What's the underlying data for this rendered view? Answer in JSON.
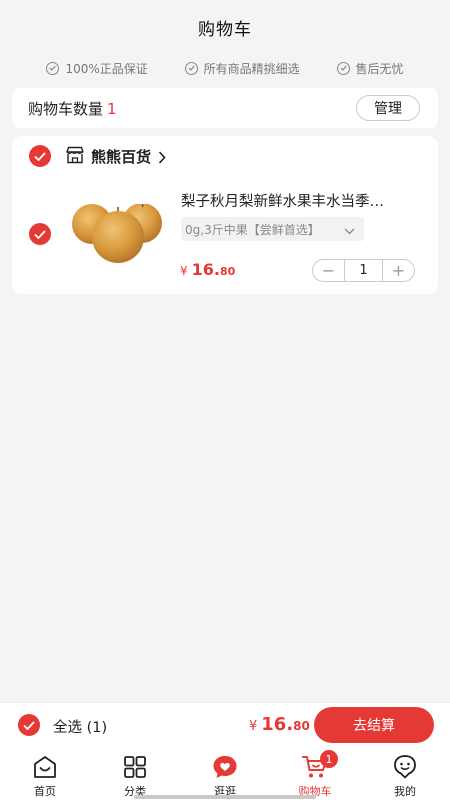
{
  "header": {
    "title": "购物车"
  },
  "guarantees": [
    {
      "label": "100%正品保证",
      "icon": "check-circle-icon"
    },
    {
      "label": "所有商品精挑细选",
      "icon": "check-circle-icon"
    },
    {
      "label": "售后无忧",
      "icon": "check-circle-icon"
    }
  ],
  "cart_count": {
    "label": "购物车数量",
    "value": "1",
    "manage_label": "管理"
  },
  "store": {
    "name": "熊熊百货",
    "item": {
      "title": "梨子秋月梨新鲜水果丰水当季…",
      "variant": "0g,3斤中果【尝鲜首选】",
      "price_currency": "¥",
      "price_int": "16.",
      "price_dec": "80",
      "quantity": "1",
      "minus": "−",
      "plus": "+"
    }
  },
  "checkout": {
    "select_all": "全选 (1)",
    "total_currency": "¥",
    "total_int": "16.",
    "total_dec": "80",
    "button": "去结算"
  },
  "tabs": [
    {
      "label": "首页",
      "icon": "home-icon"
    },
    {
      "label": "分类",
      "icon": "category-grid-icon"
    },
    {
      "label": "逛逛",
      "icon": "heart-chat-icon"
    },
    {
      "label": "购物车",
      "icon": "cart-icon",
      "badge": "1",
      "active": true
    },
    {
      "label": "我的",
      "icon": "profile-icon"
    }
  ],
  "colors": {
    "accent": "#e53935",
    "background": "#f4f4f4"
  }
}
